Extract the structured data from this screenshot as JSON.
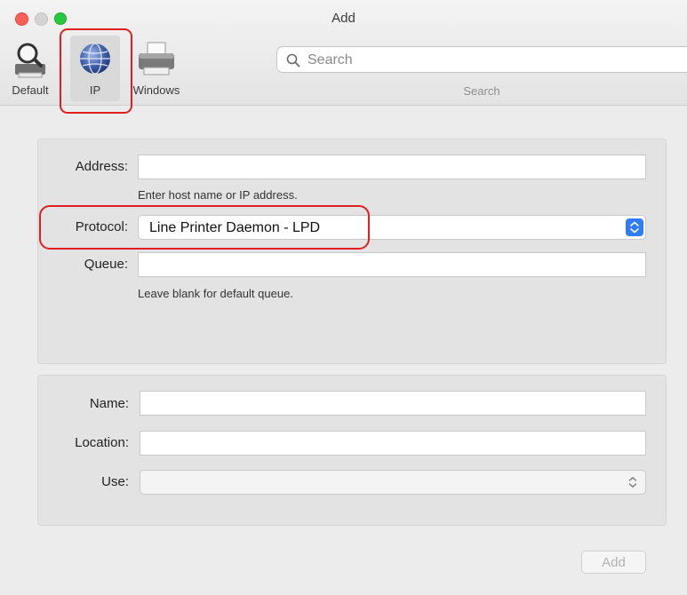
{
  "window": {
    "title": "Add"
  },
  "toolbar": {
    "items": [
      {
        "label": "Default",
        "icon": "magnifier-printer-icon"
      },
      {
        "label": "IP",
        "icon": "globe-icon"
      },
      {
        "label": "Windows",
        "icon": "printer-icon"
      }
    ],
    "search": {
      "placeholder": "Search",
      "label": "Search"
    }
  },
  "form": {
    "address": {
      "label": "Address:",
      "value": "",
      "hint": "Enter host name or IP address."
    },
    "protocol": {
      "label": "Protocol:",
      "value": "Line Printer Daemon - LPD"
    },
    "queue": {
      "label": "Queue:",
      "value": "",
      "hint": "Leave blank for default queue."
    },
    "name": {
      "label": "Name:",
      "value": ""
    },
    "location": {
      "label": "Location:",
      "value": ""
    },
    "use": {
      "label": "Use:",
      "value": ""
    }
  },
  "buttons": {
    "add": "Add"
  },
  "colors": {
    "highlight": "#e02020",
    "accent": "#2f7cf6",
    "close": "#fe5f57",
    "zoom": "#28c840"
  }
}
